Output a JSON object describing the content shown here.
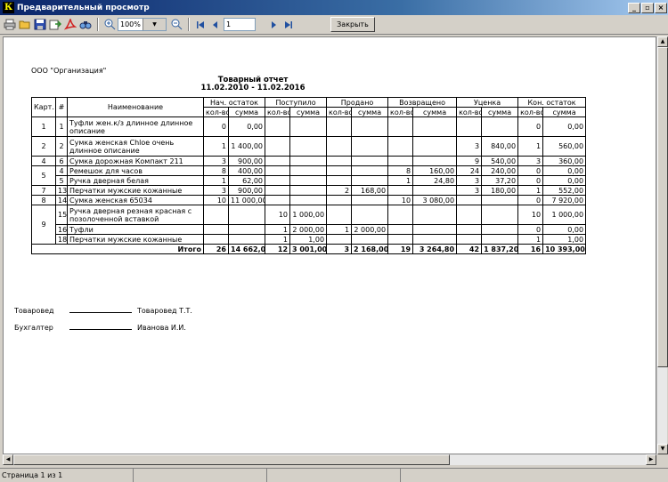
{
  "window": {
    "title": "Предварительный просмотр",
    "icon_letter": "К",
    "controls": [
      "_",
      "▫",
      "×"
    ]
  },
  "toolbar": {
    "icons": [
      "print-icon",
      "open-icon",
      "save-icon",
      "export-icon",
      "pdf-icon",
      "find-icon",
      "zoom-in-icon",
      "zoom-out-icon",
      "first-page-icon",
      "prev-page-icon",
      "next-page-icon",
      "last-page-icon"
    ],
    "zoom_value": "100%",
    "page_value": "1",
    "close_label": "Закрыть"
  },
  "report": {
    "organization": "ООО \"Организация\"",
    "title": "Товарный отчет",
    "period": "11.02.2010 - 11.02.2016",
    "header": {
      "card": "Карт.",
      "num": "#",
      "name": "Наименование",
      "groups": [
        "Нач. остаток",
        "Поступило",
        "Продано",
        "Возвращено",
        "Уценка",
        "Кон. остаток"
      ],
      "qty": "кол-во",
      "sum": "сумма"
    },
    "rows": [
      {
        "card": "1",
        "num": "1",
        "name": "Туфли жен.к/з длинное длинное описание",
        "v": [
          "0",
          "0,00",
          "",
          "",
          "",
          "",
          "",
          "",
          "",
          "",
          "0",
          "0,00"
        ]
      },
      {
        "card": "2",
        "num": "2",
        "name": "Сумка женская Chloe очень длинное описание",
        "v": [
          "1",
          "1 400,00",
          "",
          "",
          "",
          "",
          "",
          "",
          "3",
          "840,00",
          "1",
          "560,00"
        ]
      },
      {
        "card": "4",
        "num": "6",
        "name": "Сумка дорожная Компакт 211",
        "v": [
          "3",
          "900,00",
          "",
          "",
          "",
          "",
          "",
          "",
          "9",
          "540,00",
          "3",
          "360,00"
        ]
      },
      {
        "card": "5",
        "num": "4",
        "name": "Ремешок для часов",
        "v": [
          "8",
          "400,00",
          "",
          "",
          "",
          "",
          "8",
          "160,00",
          "24",
          "240,00",
          "0",
          "0,00"
        ]
      },
      {
        "card": "",
        "num": "5",
        "name": "Ручка дверная белая",
        "v": [
          "1",
          "62,00",
          "",
          "",
          "",
          "",
          "1",
          "24,80",
          "3",
          "37,20",
          "0",
          "0,00"
        ]
      },
      {
        "card": "7",
        "num": "13",
        "name": "Перчатки мужские кожанные",
        "v": [
          "3",
          "900,00",
          "",
          "",
          "2",
          "168,00",
          "",
          "",
          "3",
          "180,00",
          "1",
          "552,00"
        ]
      },
      {
        "card": "8",
        "num": "14",
        "name": "Сумка женская 65034",
        "v": [
          "10",
          "11 000,00",
          "",
          "",
          "",
          "",
          "10",
          "3 080,00",
          "",
          "",
          "0",
          "7 920,00"
        ]
      },
      {
        "card": "9",
        "num": "15",
        "name": "Ручка дверная резная красная с позолоченной вставкой",
        "v": [
          "",
          "",
          "10",
          "1 000,00",
          "",
          "",
          "",
          "",
          "",
          "",
          "10",
          "1 000,00"
        ]
      },
      {
        "card": "",
        "num": "16",
        "name": "Туфли",
        "v": [
          "",
          "",
          "1",
          "2 000,00",
          "1",
          "2 000,00",
          "",
          "",
          "",
          "",
          "0",
          "0,00"
        ]
      },
      {
        "card": "",
        "num": "18",
        "name": "Перчатки мужские кожанные",
        "v": [
          "",
          "",
          "1",
          "1,00",
          "",
          "",
          "",
          "",
          "",
          "",
          "1",
          "1,00"
        ]
      }
    ],
    "total": {
      "label": "Итого",
      "v": [
        "26",
        "14 662,00",
        "12",
        "3 001,00",
        "3",
        "2 168,00",
        "19",
        "3 264,80",
        "42",
        "1 837,20",
        "16",
        "10 393,00"
      ]
    },
    "signatures": [
      {
        "role": "Товаровед",
        "person": "Товаровед Т.Т."
      },
      {
        "role": "Бухгалтер",
        "person": "Иванова И.И."
      }
    ]
  },
  "status": {
    "page_info": "Страница 1 из 1"
  }
}
